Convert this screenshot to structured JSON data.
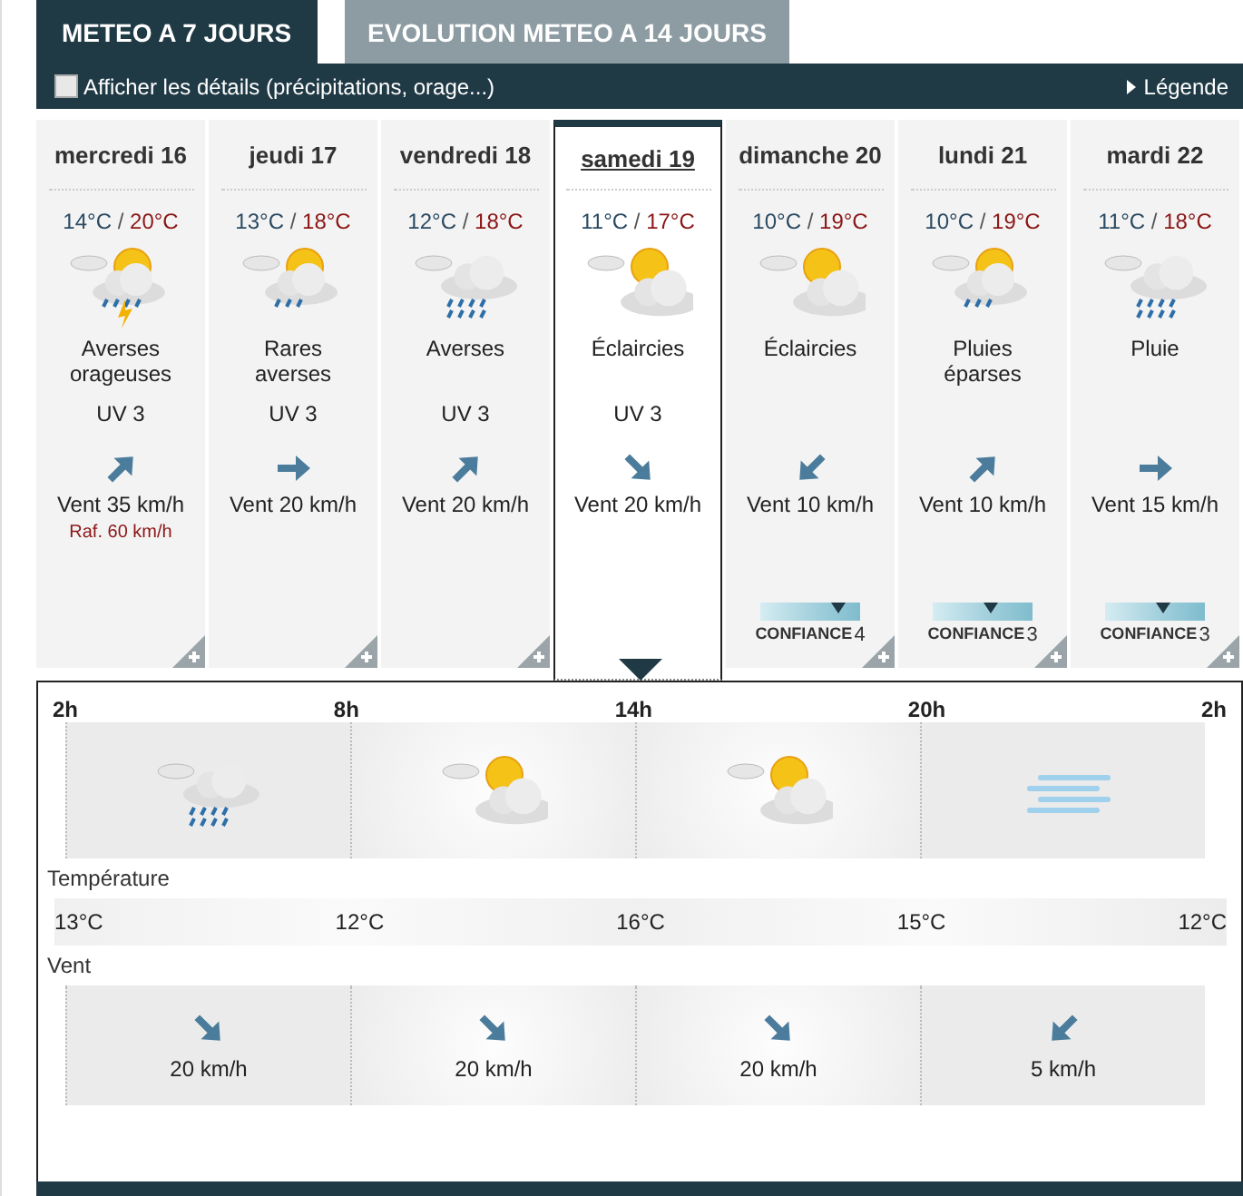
{
  "tabs": [
    {
      "label": "METEO A 7 JOURS",
      "selected": true
    },
    {
      "label": "EVOLUTION METEO A 14 JOURS",
      "selected": false
    }
  ],
  "toolbar": {
    "details_checkbox": {
      "label": "Afficher les détails (précipitations, orage...)",
      "checked": false
    },
    "legend_link": "Légende"
  },
  "days": [
    {
      "label": "mercredi 16",
      "selected": false,
      "min": "14°C",
      "separator": "/",
      "max": "20°C",
      "sky_icon": {
        "kind": "storm"
      },
      "condition": "Averses orageuses",
      "uv": "UV 3",
      "wind_arrow": {
        "kind": "ne"
      },
      "wind": "Vent 35 km/h",
      "gust": "Raf. 60 km/h"
    },
    {
      "label": "jeudi 17",
      "selected": false,
      "min": "13°C",
      "separator": "/",
      "max": "18°C",
      "sky_icon": {
        "kind": "drizzle"
      },
      "condition": "Rares averses",
      "uv": "UV 3",
      "wind_arrow": {
        "kind": "e"
      },
      "wind": "Vent 20 km/h"
    },
    {
      "label": "vendredi 18",
      "selected": false,
      "min": "12°C",
      "separator": "/",
      "max": "18°C",
      "sky_icon": {
        "kind": "rain"
      },
      "condition": "Averses",
      "uv": "UV 3",
      "wind_arrow": {
        "kind": "ne"
      },
      "wind": "Vent 20 km/h"
    },
    {
      "label": "samedi 19",
      "selected": true,
      "min": "11°C",
      "separator": "/",
      "max": "17°C",
      "sky_icon": {
        "kind": "cloudsun"
      },
      "condition": "Éclaircies",
      "uv": "UV 3",
      "wind_arrow": {
        "kind": "se"
      },
      "wind": "Vent 20 km/h"
    },
    {
      "label": "dimanche 20",
      "selected": false,
      "min": "10°C",
      "separator": "/",
      "max": "19°C",
      "sky_icon": {
        "kind": "cloudsun"
      },
      "condition": "Éclaircies",
      "wind_arrow": {
        "kind": "sw"
      },
      "wind": "Vent 10 km/h",
      "confidence": {
        "label": "CONFIANCE",
        "value": "4",
        "level": 0.78
      }
    },
    {
      "label": "lundi 21",
      "selected": false,
      "min": "10°C",
      "separator": "/",
      "max": "19°C",
      "sky_icon": {
        "kind": "drizzle"
      },
      "condition": "Pluies éparses",
      "wind_arrow": {
        "kind": "ne"
      },
      "wind": "Vent 10 km/h",
      "confidence": {
        "label": "CONFIANCE",
        "value": "3",
        "level": 0.58
      }
    },
    {
      "label": "mardi 22",
      "selected": false,
      "min": "11°C",
      "separator": "/",
      "max": "18°C",
      "sky_icon": {
        "kind": "rain"
      },
      "condition": "Pluie",
      "wind_arrow": {
        "kind": "e"
      },
      "wind": "Vent 15 km/h",
      "confidence": {
        "label": "CONFIANCE",
        "value": "3",
        "level": 0.58
      }
    }
  ],
  "detail": {
    "hours": [
      "2h",
      "8h",
      "14h",
      "20h",
      "2h"
    ],
    "sky": [
      {
        "kind": "rain"
      },
      {
        "kind": "cloudsun"
      },
      {
        "kind": "cloudsun"
      },
      {
        "kind": "fog"
      }
    ],
    "temperature_label": "Température",
    "temperatures": [
      "13°C",
      "12°C",
      "16°C",
      "15°C",
      "12°C"
    ],
    "wind_label": "Vent",
    "winds": [
      {
        "arrow": {
          "kind": "se"
        },
        "speed": "20 km/h"
      },
      {
        "arrow": {
          "kind": "se"
        },
        "speed": "20 km/h"
      },
      {
        "arrow": {
          "kind": "se"
        },
        "speed": "20 km/h"
      },
      {
        "arrow": {
          "kind": "sw"
        },
        "speed": "5 km/h"
      }
    ]
  }
}
